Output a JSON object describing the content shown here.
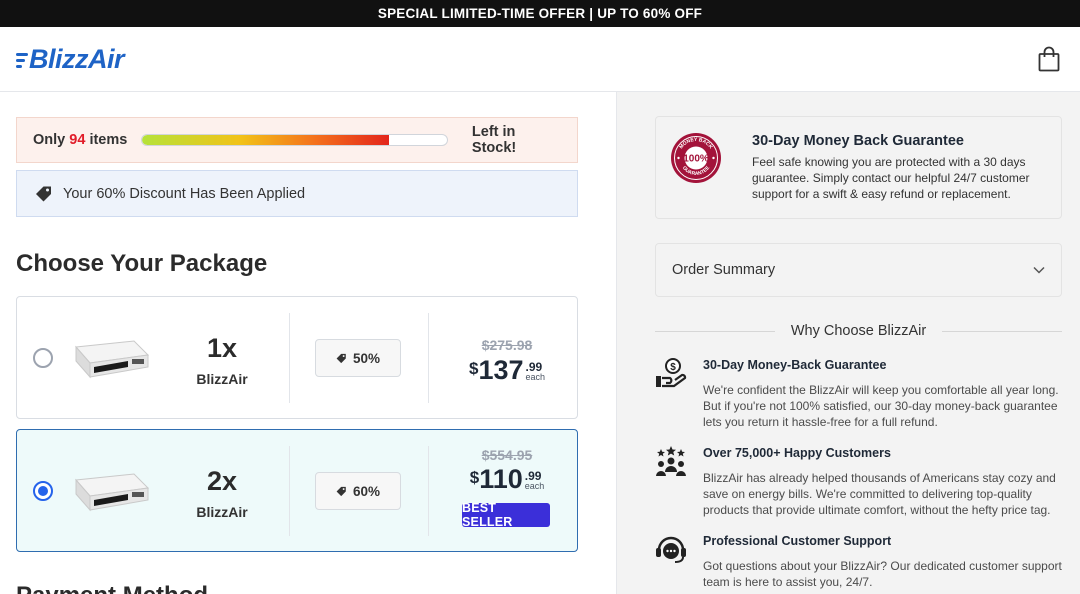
{
  "topbar": {
    "text": "SPECIAL LIMITED-TIME OFFER | UP TO 60% OFF"
  },
  "header": {
    "logo_text": "BlizzAir",
    "cart_icon": "shopping-bag-icon"
  },
  "stock": {
    "prefix": "Only",
    "count": "94",
    "suffix": "items",
    "right_text": "Left in Stock!",
    "level": 0.81
  },
  "discount": {
    "text": "Your 60% Discount Has Been Applied",
    "icon": "tag-icon"
  },
  "choose": {
    "title": "Choose Your Package"
  },
  "packages": [
    {
      "qty": "1x",
      "name": "BlizzAir",
      "discount": "50%",
      "was": "$275.98",
      "dollar": "$",
      "price": "137",
      "cents": ".99",
      "each": "each",
      "selected": false
    },
    {
      "qty": "2x",
      "name": "BlizzAir",
      "discount": "60%",
      "was": "$554.95",
      "dollar": "$",
      "price": "110",
      "cents": ".99",
      "each": "each",
      "selected": true,
      "badge": "BEST SELLER"
    }
  ],
  "payment": {
    "title": "Payment Method"
  },
  "guarantee": {
    "seal_top": "MONEY BACK",
    "seal_mid": "100%",
    "seal_bottom": "GUARANTEE",
    "title": "30-Day Money Back Guarantee",
    "text": "Feel safe knowing you are protected with a 30 days guarantee. Simply contact our helpful 24/7 customer support for a swift & easy refund or replacement."
  },
  "summary": {
    "label": "Order Summary"
  },
  "why": {
    "title": "Why Choose BlizzAir",
    "features": [
      {
        "icon": "money-hand-icon",
        "title": "30-Day Money-Back Guarantee",
        "text": "We're confident the BlizzAir will keep you comfortable all year long. But if you're not 100% satisfied, our 30-day money-back guarantee lets you return it hassle-free for a full refund."
      },
      {
        "icon": "customers-stars-icon",
        "title": "Over 75,000+ Happy Customers",
        "text": "BlizzAir has already helped thousands of Americans stay cozy and save on energy bills. We're committed to delivering top-quality products that provide ultimate comfort, without the hefty price tag."
      },
      {
        "icon": "support-headset-icon",
        "title": "Professional Customer Support",
        "text": "Got questions about your BlizzAir? Our dedicated customer support team is here to assist you, 24/7."
      }
    ]
  },
  "colors": {
    "brand": "#1e63c6",
    "accent_red": "#e11d2a",
    "badge": "#3b2fd9",
    "seal": "#a3133a"
  }
}
